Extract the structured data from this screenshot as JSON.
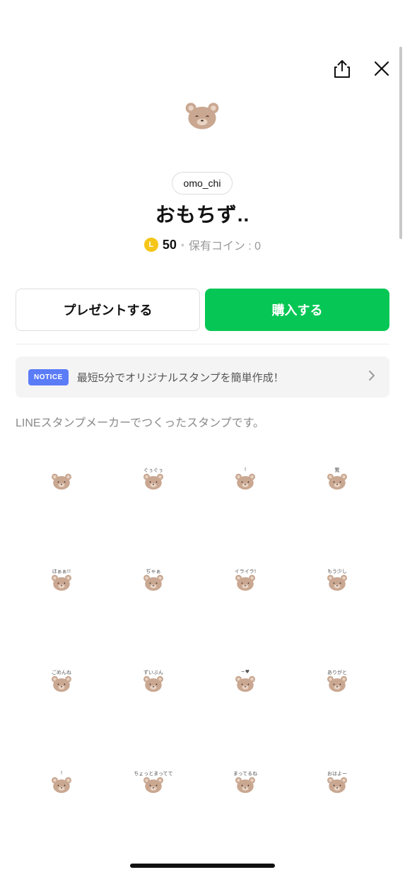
{
  "header": {
    "share_icon": "share-icon",
    "close_icon": "close-icon"
  },
  "product": {
    "author": "omo_chi",
    "title": "おもちず..",
    "coin_symbol": "L",
    "price": "50",
    "separator": "•",
    "owned_coins": "保有コイン : 0"
  },
  "actions": {
    "gift_label": "プレゼントする",
    "buy_label": "購入する"
  },
  "notice": {
    "badge": "NOTICE",
    "text": "最短5分でオリジナルスタンプを簡単作成！"
  },
  "description": "LINEスタンプメーカーでつくったスタンプです。",
  "colors": {
    "accent": "#06c755",
    "notice_badge": "#5b7cf7",
    "coin": "#f5c518",
    "bear": "#c9a791"
  },
  "stickers": [
    {
      "caption": ""
    },
    {
      "caption": "ぐぅぐぅ"
    },
    {
      "caption": "!"
    },
    {
      "caption": "驚"
    },
    {
      "caption": "ほぁぁ!!"
    },
    {
      "caption": "ぢゃぁ"
    },
    {
      "caption": "イライラ!"
    },
    {
      "caption": "もう少し"
    },
    {
      "caption": "ごめんね"
    },
    {
      "caption": "ずいぶん"
    },
    {
      "caption": "~♥"
    },
    {
      "caption": "ありがと"
    },
    {
      "caption": "!"
    },
    {
      "caption": "ちょっとまってて"
    },
    {
      "caption": "まってるね"
    },
    {
      "caption": "おはよー"
    }
  ]
}
